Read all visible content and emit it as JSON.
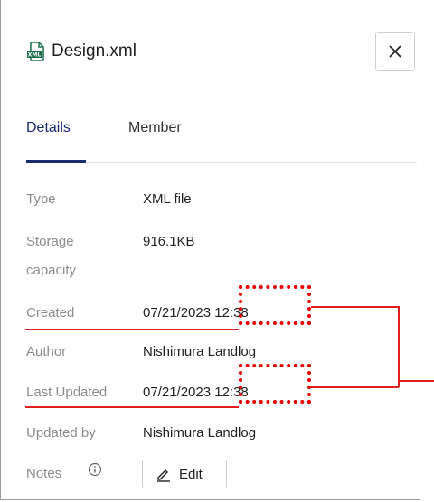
{
  "panel": {
    "title": "Design.xml",
    "icon": "xml-file-icon",
    "close_label": "X"
  },
  "tabs": [
    {
      "label": "Details",
      "active": true
    },
    {
      "label": "Member",
      "active": false
    }
  ],
  "details": {
    "type_label": "Type",
    "type_value": "XML file",
    "storage_label_1": "Storage",
    "storage_label_2": "capacity",
    "storage_value": "916.1KB",
    "created_label": "Created",
    "created_value": "07/21/2023 12:38",
    "author_label": "Author",
    "author_value": "Nishimura Landlog",
    "last_updated_label": "Last Updated",
    "last_updated_value": "07/21/2023 12:38",
    "updated_by_label": "Updated by",
    "updated_by_value": "Nishimura Landlog",
    "notes_label": "Notes",
    "edit_label": "Edit"
  },
  "colors": {
    "accent": "#1a2b6d",
    "annotation": "#e60000",
    "label_gray": "#8c8c8c"
  }
}
